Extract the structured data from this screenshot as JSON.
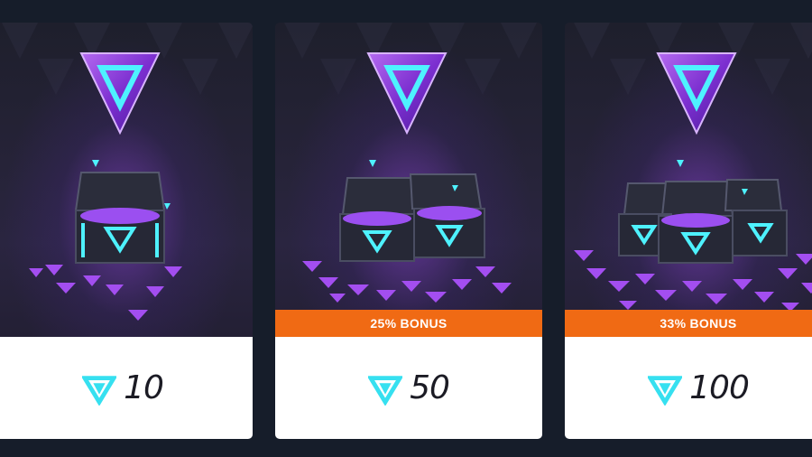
{
  "shop": {
    "packs": [
      {
        "amount": "10",
        "bonus": "",
        "chests": 1
      },
      {
        "amount": "50",
        "bonus": "25% BONUS",
        "chests": 2
      },
      {
        "amount": "100",
        "bonus": "33% BONUS",
        "chests": 3
      }
    ]
  },
  "icons": {
    "currency": "triangle-gem-icon",
    "chest": "treasure-chest-icon"
  },
  "colors": {
    "background": "#161d2a",
    "bonus_banner": "#f06a14",
    "gem_accent": "#36e0f0",
    "gem_purple": "#8a3fd6",
    "price_panel": "#ffffff"
  }
}
